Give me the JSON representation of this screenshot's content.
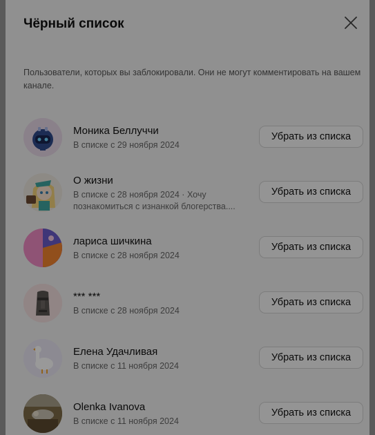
{
  "dialog": {
    "title": "Чёрный список",
    "description": "Пользователи, которых вы заблокировали. Они не могут комментировать на вашем канале.",
    "remove_label": "Убрать из списка"
  },
  "users": [
    {
      "name": "Моника Беллуччи",
      "subtitle": "В списке с 29 ноября 2024",
      "avatar": "robot-avatar"
    },
    {
      "name": "О жизни",
      "subtitle": "В списке с 28 ноября 2024 · Хочу познакомиться с изнанкой блогерства....",
      "avatar": "anime-girl-avatar"
    },
    {
      "name": "лариса шичкина",
      "subtitle": "В списке с 28 ноября 2024",
      "avatar": "abstract-shapes-avatar"
    },
    {
      "name": "*** ***",
      "subtitle": "В списке с 28 ноября 2024",
      "avatar": "moai-avatar"
    },
    {
      "name": "Елена Удачливая",
      "subtitle": "В списке с 11 ноября 2024",
      "avatar": "goose-avatar"
    },
    {
      "name": "Olenka Ivanova",
      "subtitle": "В списке с 11 ноября 2024",
      "avatar": "photo-avatar"
    }
  ]
}
